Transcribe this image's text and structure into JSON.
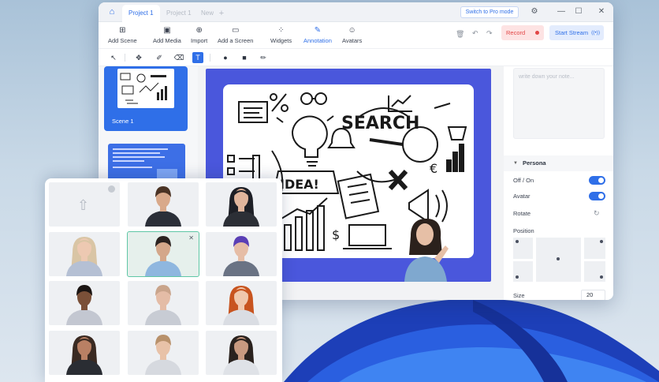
{
  "titlebar": {
    "home_icon": "home-icon",
    "tabs": [
      {
        "label": "Project 1",
        "active": true
      },
      {
        "label": "Project 1",
        "active": false
      },
      {
        "label": "New",
        "active": false
      }
    ],
    "add_tab": "+",
    "pro_mode_label": "Switch to Pro mode",
    "controls": {
      "settings": "⚙",
      "minimize": "—",
      "maximize": "☐",
      "close": "✕"
    }
  },
  "toolbar": {
    "items": [
      {
        "label": "Add Scene",
        "icon": "plus-square-icon",
        "glyph": "⊞"
      },
      {
        "label": "Add Media",
        "icon": "image-icon",
        "glyph": "▣"
      },
      {
        "label": "Import",
        "icon": "import-icon",
        "glyph": "⊕"
      },
      {
        "label": "Add a Screen",
        "icon": "screen-icon",
        "glyph": "▭"
      },
      {
        "label": "Widgets",
        "icon": "widgets-icon",
        "glyph": "⁘"
      },
      {
        "label": "Annotation",
        "icon": "annotation-icon",
        "glyph": "✎",
        "active": true
      },
      {
        "label": "Avatars",
        "icon": "avatars-icon",
        "glyph": "☺"
      }
    ],
    "record_label": "Record",
    "stream_label": "Start Stream",
    "stream_icon": "((•))",
    "trash_glyph": "🗑",
    "undo_glyph": "↶",
    "redo_glyph": "↷"
  },
  "annotation_tools": [
    {
      "name": "pointer",
      "glyph": "↖"
    },
    {
      "name": "stamp",
      "glyph": "✥"
    },
    {
      "name": "highlighter",
      "glyph": "✐"
    },
    {
      "name": "eraser",
      "glyph": "⌫"
    },
    {
      "name": "text",
      "glyph": "T",
      "active": true
    },
    {
      "name": "circle",
      "glyph": "●"
    },
    {
      "name": "square",
      "glyph": "■"
    },
    {
      "name": "pen",
      "glyph": "✏"
    }
  ],
  "scenes": [
    {
      "label": "Scene 1"
    }
  ],
  "canvas": {
    "whiteboard_word_search": "SEARCH",
    "whiteboard_word_idea": "IDEA!"
  },
  "right_panel": {
    "note_placeholder": "write down your note...",
    "persona_title": "Persona",
    "rows": [
      {
        "label": "Off / On",
        "type": "toggle",
        "on": true
      },
      {
        "label": "Avatar",
        "type": "toggle",
        "on": true
      },
      {
        "label": "Rotate",
        "type": "icon"
      }
    ],
    "position_label": "Position",
    "size_label": "Size",
    "size_value": "20"
  },
  "avatar_panel": {
    "upload_glyph": "⇧",
    "close_glyph": "✕",
    "avatars": [
      {
        "type": "upload"
      },
      {
        "hair": "#4a3324",
        "skin": "#d9a98a",
        "shirt": "#2b2f38",
        "gender": "m"
      },
      {
        "hair": "#1d1f26",
        "skin": "#e0b59c",
        "shirt": "#2c2f36",
        "gender": "f"
      },
      {
        "hair": "#d9c5a5",
        "skin": "#edc9b2",
        "shirt": "#b5c0d4",
        "gender": "f"
      },
      {
        "hair": "#2a2220",
        "skin": "#d4a78a",
        "shirt": "#8fb7df",
        "gender": "m",
        "selected": true
      },
      {
        "hair": "#5a3fb5",
        "skin": "#e6bda6",
        "shirt": "#6a7384",
        "gender": "m"
      },
      {
        "hair": "#1b1513",
        "skin": "#7a5038",
        "shirt": "#c3c7d1",
        "gender": "m"
      },
      {
        "hair": "#c9a48b",
        "skin": "#e4bca6",
        "shirt": "#c8ccd4",
        "gender": "m"
      },
      {
        "hair": "#c8541f",
        "skin": "#f0c8ad",
        "shirt": "#dadde3",
        "gender": "f"
      },
      {
        "hair": "#3a2a22",
        "skin": "#b98064",
        "shirt": "#2a2d33",
        "gender": "f"
      },
      {
        "hair": "#b8916b",
        "skin": "#e8c2a8",
        "shirt": "#d6d9df",
        "gender": "m"
      },
      {
        "hair": "#2a221e",
        "skin": "#c99a80",
        "shirt": "#dfe2e7",
        "gender": "f"
      }
    ]
  },
  "colors": {
    "accent": "#2f6fe8",
    "canvas_blue": "#4a57dc",
    "record": "#e24646"
  }
}
